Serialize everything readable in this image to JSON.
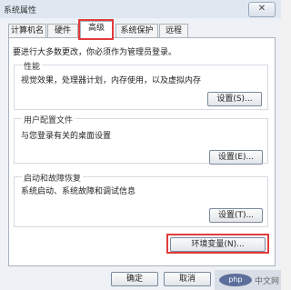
{
  "window": {
    "title": "系统属性",
    "close_label": "✕"
  },
  "tabs": [
    {
      "label": "计算机名"
    },
    {
      "label": "硬件"
    },
    {
      "label": "高级"
    },
    {
      "label": "系统保护"
    },
    {
      "label": "远程"
    }
  ],
  "active_tab": "高级",
  "note": "要进行大多数更改，你必须作为管理员登录。",
  "groups": {
    "performance": {
      "title": "性能",
      "description": "视觉效果，处理器计划，内存使用，以及虚拟内存",
      "button": "设置(S)..."
    },
    "profiles": {
      "title": "用户配置文件",
      "description": "与您登录有关的桌面设置",
      "button": "设置(E)..."
    },
    "startup": {
      "title": "启动和故障恢复",
      "description": "系统启动、系统故障和调试信息",
      "button": "设置(T)..."
    }
  },
  "env_button": "环境变量(N)...",
  "footer": {
    "ok": "确定",
    "cancel": "取消"
  },
  "watermark": {
    "logo": "php",
    "text": "中文网"
  },
  "colors": {
    "highlight": "#e13b3b"
  }
}
